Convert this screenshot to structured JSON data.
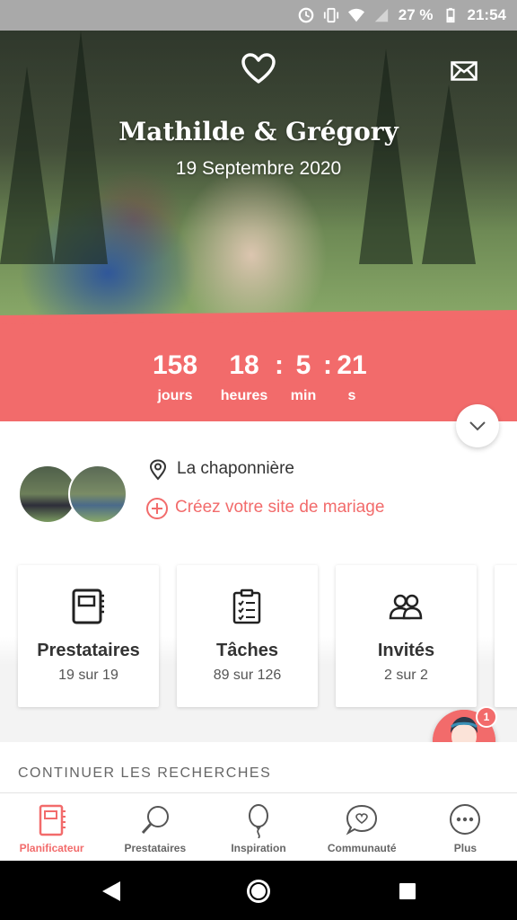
{
  "status_bar": {
    "battery_percent": "27 %",
    "time": "21:54",
    "icons": [
      "sync-icon",
      "vibrate-icon",
      "wifi-icon",
      "signal-icon",
      "battery-icon"
    ]
  },
  "hero": {
    "couple_name": "Mathilde & Grégory",
    "wedding_date": "19 Septembre 2020",
    "icons": [
      "heart-icon",
      "mail-icon"
    ]
  },
  "countdown": {
    "days": "158",
    "days_label": "jours",
    "hours": "18",
    "hours_label": "heures",
    "minutes": "5",
    "minutes_label": "min",
    "seconds": "21",
    "seconds_label": "s",
    "separator": ":"
  },
  "info": {
    "location": "La chaponnière",
    "create_site_label": "Créez votre site de mariage"
  },
  "cards": [
    {
      "title": "Prestataires",
      "count": "19 sur 19",
      "icon": "planner-book-icon"
    },
    {
      "title": "Tâches",
      "count": "89 sur 126",
      "icon": "clipboard-checklist-icon"
    },
    {
      "title": "Invités",
      "count": "2 sur 2",
      "icon": "guests-icon"
    }
  ],
  "assistant": {
    "notification_count": "1"
  },
  "continue_section": {
    "title": "CONTINUER LES RECHERCHES"
  },
  "bottom_nav": [
    {
      "label": "Planificateur",
      "icon": "planner-book-icon",
      "active": true
    },
    {
      "label": "Prestataires",
      "icon": "magnifier-icon",
      "active": false
    },
    {
      "label": "Inspiration",
      "icon": "balloon-icon",
      "active": false
    },
    {
      "label": "Communauté",
      "icon": "chat-heart-icon",
      "active": false
    },
    {
      "label": "Plus",
      "icon": "more-dots-icon",
      "active": false
    }
  ],
  "colors": {
    "accent": "#f26b6b",
    "status_bar": "#a9a9a9",
    "system_nav": "#000000"
  }
}
